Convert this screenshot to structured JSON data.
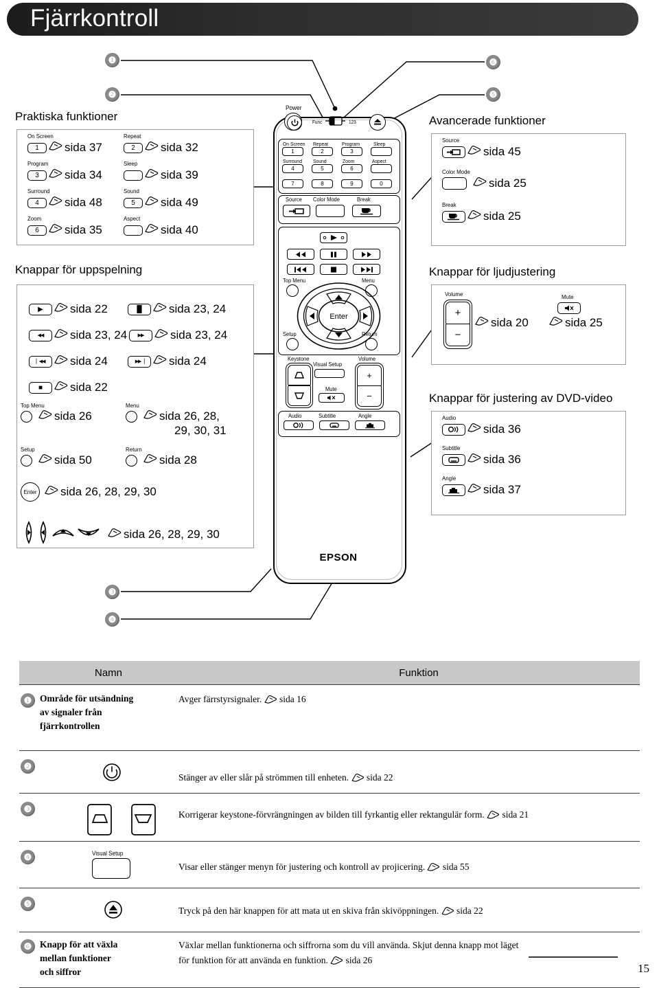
{
  "header": {
    "title": "Fjärrkontroll"
  },
  "page_number": "15",
  "callouts": {
    "c1": "❶",
    "c2": "❷",
    "c3": "❸",
    "c4": "❹",
    "c5": "❺",
    "c6": "❻"
  },
  "sections": {
    "practical": {
      "title": "Praktiska funktioner",
      "items": [
        {
          "label": "On Screen",
          "key": "1",
          "ref": "sida 37"
        },
        {
          "label": "Repeat",
          "key": "2",
          "ref": "sida 32"
        },
        {
          "label": "Program",
          "key": "3",
          "ref": "sida 34"
        },
        {
          "label": "Sleep",
          "key": "",
          "ref": "sida 39"
        },
        {
          "label": "Surround",
          "key": "4",
          "ref": "sida 48"
        },
        {
          "label": "Sound",
          "key": "5",
          "ref": "sida 49"
        },
        {
          "label": "Zoom",
          "key": "6",
          "ref": "sida 35"
        },
        {
          "label": "Aspect",
          "key": "",
          "ref": "sida 40"
        }
      ]
    },
    "playback": {
      "title": "Knappar för uppspelning",
      "items": [
        {
          "icon": "play-icon",
          "glyph": "▶",
          "ref": "sida 22"
        },
        {
          "icon": "pause-icon",
          "glyph": "▐▌",
          "ref": "sida 23, 24"
        },
        {
          "icon": "rewind-icon",
          "glyph": "◀◀",
          "ref": "sida 23, 24"
        },
        {
          "icon": "fastforward-icon",
          "glyph": "▶▶",
          "ref": "sida 23, 24"
        },
        {
          "icon": "prev-track-icon",
          "glyph": "▏◀◀",
          "ref": "sida 24"
        },
        {
          "icon": "next-track-icon",
          "glyph": "▶▶▕",
          "ref": "sida 24"
        },
        {
          "icon": "stop-icon",
          "glyph": "■",
          "ref": "sida 22"
        }
      ],
      "round": [
        {
          "label": "Top Menu",
          "ref": "sida 26"
        },
        {
          "label": "Menu",
          "ref": "sida 26, 28,",
          "ref2": "29, 30, 31"
        },
        {
          "label": "Setup",
          "ref": "sida 50"
        },
        {
          "label": "Return",
          "ref": "sida 28"
        }
      ],
      "enter": {
        "label": "Enter",
        "ref": "sida 26, 28, 29, 30"
      },
      "arrows": {
        "ref": "sida 26, 28, 29, 30"
      }
    },
    "advanced": {
      "title": "Avancerade funktioner",
      "items": [
        {
          "label": "Source",
          "icon": "source-icon",
          "ref": "sida 45"
        },
        {
          "label": "Color Mode",
          "icon": "blank-icon",
          "ref": "sida 25"
        },
        {
          "label": "Break",
          "icon": "coffee-cup-icon",
          "ref": "sida 25"
        }
      ]
    },
    "audio": {
      "title": "Knappar för ljudjustering",
      "volume_label": "Volume",
      "volume_plus": "+",
      "volume_minus": "−",
      "volume_ref": "sida 20",
      "mute_label": "Mute",
      "mute_ref": "sida 25"
    },
    "dvd": {
      "title": "Knappar för justering av DVD-video",
      "items": [
        {
          "label": "Audio",
          "icon": "audio-icon",
          "ref": "sida 36"
        },
        {
          "label": "Subtitle",
          "icon": "subtitle-icon",
          "ref": "sida 36"
        },
        {
          "label": "Angle",
          "icon": "angle-icon",
          "ref": "sida 37"
        }
      ]
    }
  },
  "remote": {
    "brand": "EPSON",
    "power_label": "Power",
    "func_label": "Func",
    "num_label": "123",
    "eject_icon": "eject-icon",
    "numeric": [
      {
        "label": "On Screen",
        "key": "1"
      },
      {
        "label": "Repeat",
        "key": "2"
      },
      {
        "label": "Program",
        "key": "3"
      },
      {
        "label": "Sleep",
        "key": ""
      },
      {
        "label": "Surround",
        "key": "4"
      },
      {
        "label": "Sound",
        "key": "5"
      },
      {
        "label": "Zoom",
        "key": "6"
      },
      {
        "label": "Aspect",
        "key": ""
      },
      {
        "label": "",
        "key": "7"
      },
      {
        "label": "",
        "key": "8"
      },
      {
        "label": "",
        "key": "9"
      },
      {
        "label": "",
        "key": "0"
      }
    ],
    "source_row": [
      {
        "label": "Source"
      },
      {
        "label": "Color Mode"
      },
      {
        "label": "Break"
      }
    ],
    "transport": {
      "play": "▶",
      "rewind": "◀◀",
      "pause": "▐▌",
      "forward": "▶▶",
      "prev": "▏◀◀",
      "stop": "■",
      "next": "▶▶▕"
    },
    "nav": {
      "top_menu": "Top Menu",
      "menu": "Menu",
      "setup": "Setup",
      "return": "Return",
      "enter": "Enter"
    },
    "bottom": {
      "keystone": "Keystone",
      "visual_setup": "Visual Setup",
      "volume": "Volume",
      "volume_plus": "+",
      "volume_minus": "−",
      "mute": "Mute",
      "audio": "Audio",
      "subtitle": "Subtitle",
      "angle": "Angle"
    }
  },
  "table": {
    "col_name": "Namn",
    "col_function": "Funktion",
    "rows": [
      {
        "num": "❶",
        "name": "Område för utsändning av signaler från fjärrkontrollen",
        "name_lines": [
          "Område för utsändning",
          "av signaler från",
          "fjärrkontrollen"
        ],
        "function": "Avger färrstyrsignaler.",
        "function_ref": "sida 16"
      },
      {
        "num": "❷",
        "name": "",
        "name_lines": [],
        "icon": "power-icon",
        "function": "Stänger av eller slår på strömmen till enheten.",
        "function_ref": "sida 22"
      },
      {
        "num": "❸",
        "name": "",
        "name_lines": [],
        "icon": "keystone-icons",
        "function": "Korrigerar keystone-förvrängningen av bilden till fyrkantig eller rektangulär form.",
        "function_ref": "sida 21"
      },
      {
        "num": "❹",
        "name": "",
        "name_lines": [],
        "icon": "visual-setup-button",
        "icon_label": "Visual Setup",
        "function": "Visar eller stänger menyn för justering och kontroll av projicering.",
        "function_ref": "sida 55"
      },
      {
        "num": "❺",
        "name": "",
        "name_lines": [],
        "icon": "eject-icon",
        "function": "Tryck på den här knappen för att mata ut en skiva från skivöppningen.",
        "function_ref": "sida 22"
      },
      {
        "num": "❻",
        "name": "Knapp för att växla mellan funktioner och siffror",
        "name_lines": [
          "Knapp för att växla",
          "mellan funktioner",
          "och siffror"
        ],
        "function": "Växlar mellan funktionerna och siffrorna som du vill använda. Skjut denna knapp mot läget",
        "function2": "för funktion för att använda en funktion.",
        "function_ref": "sida 26"
      }
    ]
  }
}
